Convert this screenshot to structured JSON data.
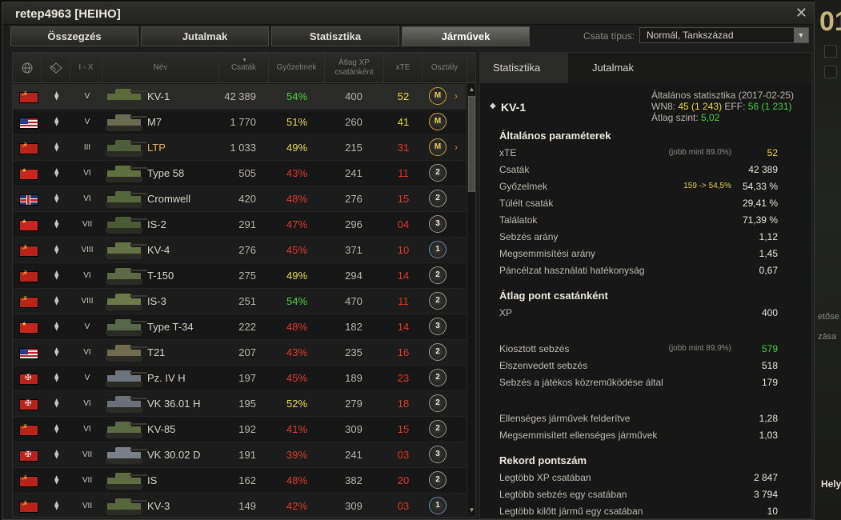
{
  "window": {
    "title": "retep4963 [HEIHO]",
    "close_glyph": "✕"
  },
  "tabs": [
    "Összegzés",
    "Jutalmak",
    "Statisztika",
    "Járművek"
  ],
  "active_tab": 3,
  "battle_type": {
    "label": "Csata típus:",
    "value": "Normál, Tankszázad"
  },
  "table": {
    "columns": {
      "tier": "I - X",
      "name": "Név",
      "battles": "Csaták",
      "wins": "Győzelmek",
      "xp": "Átlag XP csatánként",
      "xte": "xTE",
      "class": "Osztály"
    },
    "rows": [
      {
        "flag": "ussr",
        "tier": "V",
        "name": "KV-1",
        "battles": "42 389",
        "wins": "54%",
        "wc": "green",
        "xp": "400",
        "xte": "52",
        "xc": "xorange",
        "badge": "M",
        "chev": "›",
        "sel": true
      },
      {
        "flag": "usa",
        "tier": "V",
        "name": "M7",
        "battles": "1 770",
        "wins": "51%",
        "wc": "yellow",
        "xp": "260",
        "xte": "41",
        "xc": "xorange",
        "badge": "M",
        "chev": ""
      },
      {
        "flag": "ussr",
        "tier": "III",
        "name": "LTP",
        "battles": "1 033",
        "wins": "49%",
        "wc": "yellow",
        "xp": "215",
        "xte": "31",
        "xc": "xred",
        "badge": "M",
        "chev": "›",
        "namecolor": "#e8b24a"
      },
      {
        "flag": "china",
        "tier": "VI",
        "name": "Type 58",
        "battles": "505",
        "wins": "43%",
        "wc": "red",
        "xp": "241",
        "xte": "11",
        "xc": "xred",
        "badge": "2",
        "chev": ""
      },
      {
        "flag": "uk",
        "tier": "VI",
        "name": "Cromwell",
        "battles": "420",
        "wins": "48%",
        "wc": "red",
        "xp": "276",
        "xte": "15",
        "xc": "xred",
        "badge": "2",
        "chev": ""
      },
      {
        "flag": "china",
        "tier": "VII",
        "name": "IS-2",
        "battles": "291",
        "wins": "47%",
        "wc": "red",
        "xp": "296",
        "xte": "04",
        "xc": "xred",
        "badge": "3",
        "chev": ""
      },
      {
        "flag": "ussr",
        "tier": "VIII",
        "name": "KV-4",
        "battles": "276",
        "wins": "45%",
        "wc": "red",
        "xp": "371",
        "xte": "10",
        "xc": "xred",
        "badge": "1",
        "chev": ""
      },
      {
        "flag": "ussr",
        "tier": "VI",
        "name": "T-150",
        "battles": "275",
        "wins": "49%",
        "wc": "yellow",
        "xp": "294",
        "xte": "14",
        "xc": "xred",
        "badge": "2",
        "chev": ""
      },
      {
        "flag": "ussr",
        "tier": "VIII",
        "name": "IS-3",
        "battles": "251",
        "wins": "54%",
        "wc": "green",
        "xp": "470",
        "xte": "11",
        "xc": "xred",
        "badge": "2",
        "chev": ""
      },
      {
        "flag": "china",
        "tier": "V",
        "name": "Type T-34",
        "battles": "222",
        "wins": "48%",
        "wc": "red",
        "xp": "182",
        "xte": "14",
        "xc": "xred",
        "badge": "3",
        "chev": ""
      },
      {
        "flag": "usa",
        "tier": "VI",
        "name": "T21",
        "battles": "207",
        "wins": "43%",
        "wc": "red",
        "xp": "235",
        "xte": "16",
        "xc": "xred",
        "badge": "2",
        "chev": ""
      },
      {
        "flag": "ger",
        "tier": "V",
        "name": "Pz. IV H",
        "battles": "197",
        "wins": "45%",
        "wc": "red",
        "xp": "189",
        "xte": "23",
        "xc": "xred",
        "badge": "2",
        "chev": ""
      },
      {
        "flag": "ger",
        "tier": "VI",
        "name": "VK 36.01 H",
        "battles": "195",
        "wins": "52%",
        "wc": "yellow",
        "xp": "279",
        "xte": "18",
        "xc": "xred",
        "badge": "2",
        "chev": ""
      },
      {
        "flag": "ussr",
        "tier": "VI",
        "name": "KV-85",
        "battles": "192",
        "wins": "41%",
        "wc": "red",
        "xp": "309",
        "xte": "15",
        "xc": "xred",
        "badge": "2",
        "chev": ""
      },
      {
        "flag": "ger",
        "tier": "VII",
        "name": "VK 30.02 D",
        "battles": "191",
        "wins": "39%",
        "wc": "red",
        "xp": "241",
        "xte": "03",
        "xc": "xred",
        "badge": "3",
        "chev": ""
      },
      {
        "flag": "ussr",
        "tier": "VII",
        "name": "IS",
        "battles": "162",
        "wins": "48%",
        "wc": "red",
        "xp": "382",
        "xte": "20",
        "xc": "xred",
        "badge": "2",
        "chev": ""
      },
      {
        "flag": "ussr",
        "tier": "VII",
        "name": "KV-3",
        "battles": "149",
        "wins": "42%",
        "wc": "red",
        "xp": "309",
        "xte": "03",
        "xc": "xred",
        "badge": "1",
        "chev": ""
      }
    ]
  },
  "stats": {
    "tabs": [
      "Statisztika",
      "Jutalmak"
    ],
    "tank_name": "KV-1",
    "general": "Általános statisztika (2017-02-25)",
    "wn8_label": "WN8:",
    "wn8_value": "45",
    "wn8_extra": "(1 243)",
    "eff_label": "EFF:",
    "eff_value": "56",
    "eff_extra": "(1 231)",
    "level_label": "Átlag szint:",
    "level_value": "5,02",
    "sections": [
      {
        "title": "Általános paraméterek",
        "rows": [
          {
            "label": "xTE",
            "note": "(jobb mint 89.0%)",
            "value": "52",
            "vc": "y"
          },
          {
            "label": "Csaták",
            "value": "42 389"
          },
          {
            "label": "Győzelmek",
            "note": "159 -> 54,5%",
            "nc": "y",
            "value": "54,33 %"
          },
          {
            "label": "Túlélt csaták",
            "value": "29,41 %"
          },
          {
            "label": "Találatok",
            "value": "71,39 %"
          },
          {
            "label": "Sebzés arány",
            "value": "1,12"
          },
          {
            "label": "Megsemmisítési arány",
            "value": "1,45"
          },
          {
            "label": "Páncélzat használati hatékonyság",
            "value": "0,67"
          }
        ]
      },
      {
        "title": "Átlag pont csatánként",
        "rows": [
          {
            "label": "XP",
            "value": "400"
          },
          {
            "label": "Kiosztott sebzés",
            "note": "(jobb mint 89.9%)",
            "value": "579",
            "vc": "g",
            "gap": true
          },
          {
            "label": "Elszenvedett sebzés",
            "value": "518"
          },
          {
            "label": "Sebzés a játékos közreműködése által",
            "value": "179"
          },
          {
            "label": "Ellenséges járművek felderítve",
            "value": "1,28",
            "gap": true
          },
          {
            "label": "Megsemmisített ellenséges járművek",
            "value": "1,03"
          }
        ]
      },
      {
        "title": "Rekord pontszám",
        "rows": [
          {
            "label": "Legtöbb XP csatában",
            "value": "2 847"
          },
          {
            "label": "Legtöbb sebzés egy csatában",
            "value": "3 794"
          },
          {
            "label": "Legtöbb kilőtt jármű egy csatában",
            "value": "10"
          }
        ]
      }
    ]
  },
  "background": {
    "big_digits": "01",
    "frag1": "etőse",
    "frag2": "zása",
    "helyt": "Hely"
  }
}
